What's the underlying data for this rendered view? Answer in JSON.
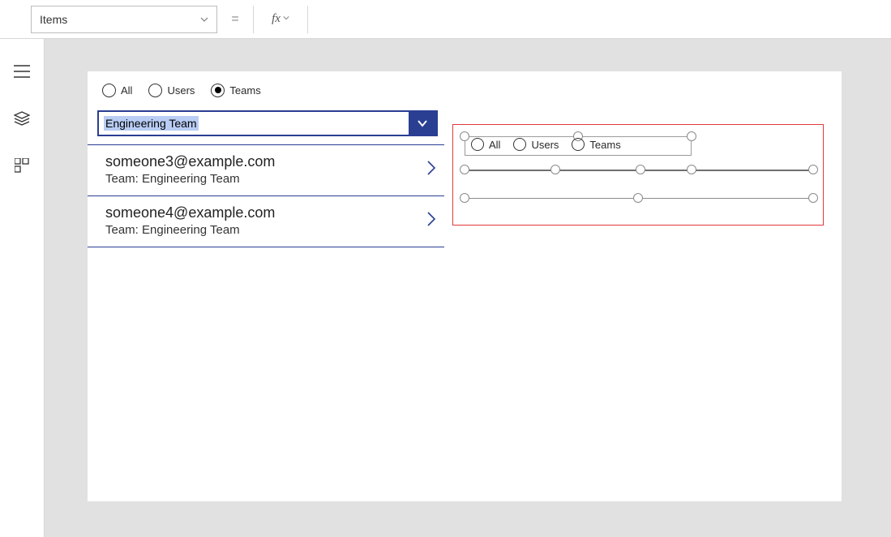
{
  "topbar": {
    "property_label": "Items",
    "equals": "=",
    "fx_label": "fx",
    "formula_value": ""
  },
  "left_rail": {
    "items": [
      {
        "name": "hamburger-icon"
      },
      {
        "name": "layers-icon"
      },
      {
        "name": "apps-icon"
      }
    ]
  },
  "app_left": {
    "radios": [
      {
        "label": "All",
        "selected": false
      },
      {
        "label": "Users",
        "selected": false
      },
      {
        "label": "Teams",
        "selected": true
      }
    ],
    "search": {
      "value": "Engineering Team"
    },
    "list": [
      {
        "primary": "someone3@example.com",
        "secondary": "Team: Engineering Team"
      },
      {
        "primary": "someone4@example.com",
        "secondary": "Team: Engineering Team"
      }
    ]
  },
  "design_right": {
    "radios": [
      {
        "label": "All"
      },
      {
        "label": "Users"
      },
      {
        "label": "Teams"
      }
    ]
  }
}
